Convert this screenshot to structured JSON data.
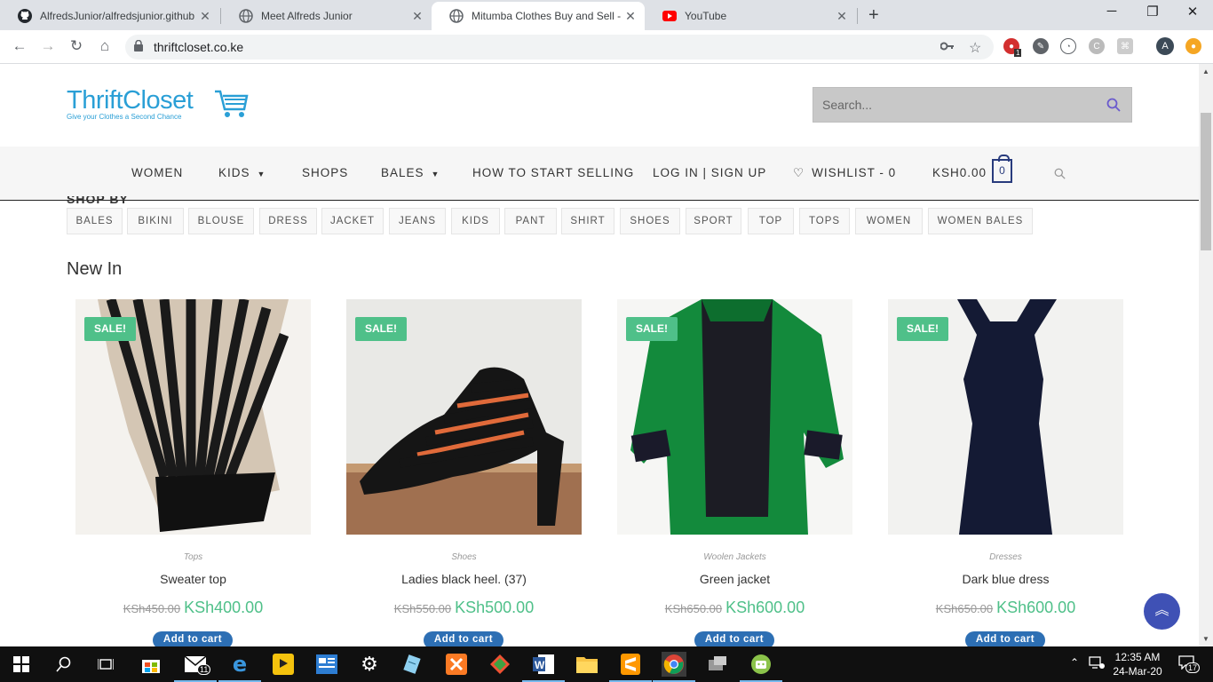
{
  "browser": {
    "tabs": [
      {
        "title": "AlfredsJunior/alfredsjunior.github",
        "icon": "github-icon",
        "active": false
      },
      {
        "title": "Meet Alfreds Junior",
        "icon": "globe-icon",
        "active": false
      },
      {
        "title": "Mitumba Clothes Buy and Sell - T",
        "icon": "globe-icon",
        "active": true
      },
      {
        "title": "YouTube",
        "icon": "youtube-icon",
        "active": false
      }
    ],
    "url": "thriftcloset.co.ke",
    "profile_initial": "A",
    "ext_badge_1": "1"
  },
  "site": {
    "logo_text_1": "Thrift",
    "logo_text_2": "Closet",
    "logo_tagline": "Give your Clothes a Second Chance",
    "search_placeholder": "Search...",
    "nav": [
      {
        "label": "WOMEN",
        "dropdown": false
      },
      {
        "label": "KIDS",
        "dropdown": true
      },
      {
        "label": "SHOPS",
        "dropdown": false
      },
      {
        "label": "BALES",
        "dropdown": true
      },
      {
        "label": "HOW TO START SELLING",
        "dropdown": false
      },
      {
        "label": "LOG IN | SIGN UP",
        "dropdown": false
      },
      {
        "label": "WISHLIST - 0",
        "dropdown": false
      },
      {
        "label": "KSH0.00",
        "dropdown": false
      }
    ],
    "cart_count": "0",
    "tags_title": "SHOP BY",
    "tags": [
      "BALES",
      "BIKINI",
      "BLOUSE",
      "DRESS",
      "JACKET",
      "JEANS",
      "KIDS",
      "PANT",
      "SHIRT",
      "SHOES",
      "SPORT",
      "TOP",
      "TOPS",
      "WOMEN",
      "WOMEN BALES"
    ],
    "section_title": "New In",
    "products": [
      {
        "badge": "SALE!",
        "category": "Tops",
        "name": "Sweater top",
        "old_price": "KSh450.00",
        "price": "KSh400.00",
        "button": "Add to cart"
      },
      {
        "badge": "SALE!",
        "category": "Shoes",
        "name": "Ladies black heel. (37)",
        "old_price": "KSh550.00",
        "price": "KSh500.00",
        "button": "Add to cart"
      },
      {
        "badge": "SALE!",
        "category": "Woolen Jackets",
        "name": "Green jacket",
        "old_price": "KSh650.00",
        "price": "KSh600.00",
        "button": "Add to cart"
      },
      {
        "badge": "SALE!",
        "category": "Dresses",
        "name": "Dark blue dress",
        "old_price": "KSh650.00",
        "price": "KSh600.00",
        "button": "Add to cart"
      }
    ]
  },
  "taskbar": {
    "mail_badge": "11",
    "time": "12:35 AM",
    "date": "24-Mar-20",
    "notif_count": "17"
  },
  "colors": {
    "accent_green": "#4fc089",
    "brand_blue": "#2a9fd6",
    "button_blue": "#2d6fb4",
    "nav_bg": "#f6f6f6"
  }
}
